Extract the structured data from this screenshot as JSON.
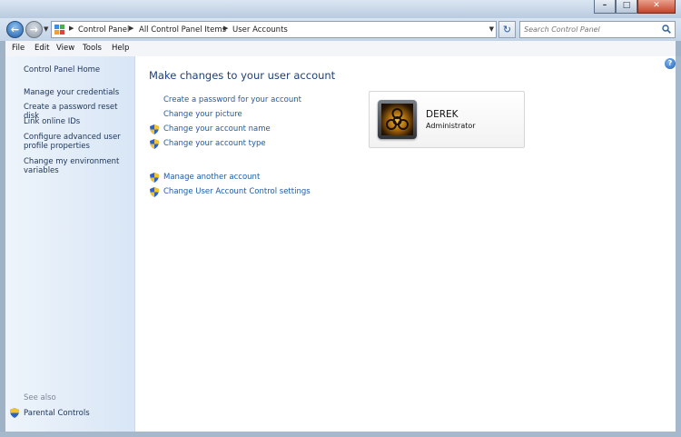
{
  "window": {
    "controls": {
      "minimize": "–",
      "maximize": "□",
      "close": "✕"
    }
  },
  "nav": {
    "back_icon": "back-arrow-icon",
    "forward_icon": "forward-arrow-icon",
    "breadcrumbs": [
      "Control Panel",
      "All Control Panel Items",
      "User Accounts"
    ],
    "search": {
      "placeholder": "Search Control Panel"
    }
  },
  "menubar": {
    "items": [
      "File",
      "Edit",
      "View",
      "Tools",
      "Help"
    ]
  },
  "left_pane": {
    "home": "Control Panel Home",
    "links": [
      "Manage your credentials",
      "Create a password reset disk",
      "Link online IDs",
      "Configure advanced user profile properties",
      "Change my environment variables"
    ],
    "see_also_label": "See also",
    "see_also_links": [
      "Parental Controls"
    ]
  },
  "main": {
    "heading": "Make changes to your user account",
    "actions": [
      {
        "label": "Create a password for your account",
        "shield": false
      },
      {
        "label": "Change your picture",
        "shield": false
      },
      {
        "label": "Change your account name",
        "shield": true
      },
      {
        "label": "Change your account type",
        "shield": true
      }
    ],
    "actions2": [
      {
        "label": "Manage another account",
        "shield": true
      },
      {
        "label": "Change User Account Control settings",
        "shield": true
      }
    ],
    "account": {
      "name": "DEREK",
      "role": "Administrator"
    },
    "help_icon": "help-icon"
  },
  "colors": {
    "link": "#1f59a6",
    "heading": "#1e3f78",
    "left_pane": "#e3edf8"
  }
}
